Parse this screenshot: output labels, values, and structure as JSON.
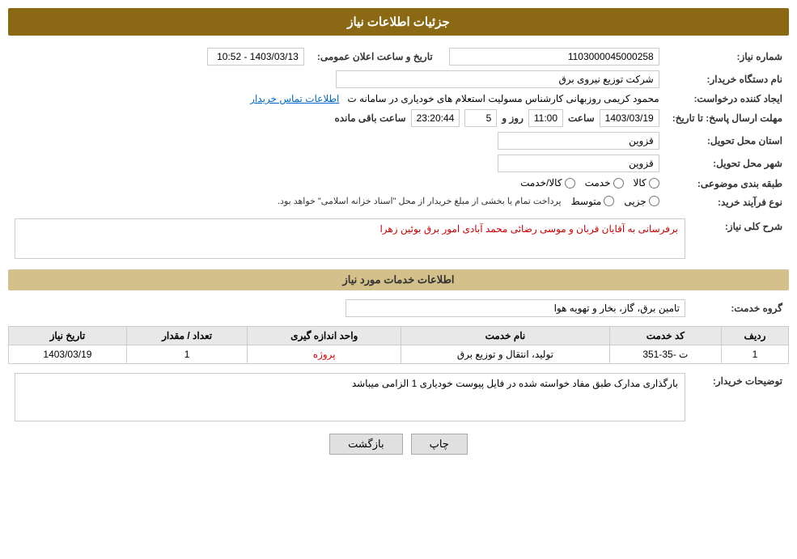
{
  "page": {
    "title": "جزئیات اطلاعات نیاز",
    "section_services": "اطلاعات خدمات مورد نیاز"
  },
  "header": {
    "announcement_label": "تاریخ و ساعت اعلان عمومی:",
    "announcement_value": "1403/03/13 - 10:52",
    "id_label": "شماره نیاز:",
    "id_value": "1103000045000258",
    "company_label": "نام دستگاه خریدار:",
    "company_value": "شرکت توزیع نیروی برق",
    "creator_label": "ایجاد کننده درخواست:",
    "creator_value": "محمود کریمی روزبهانی کارشناس  مسولیت استعلام های خودیاری در سامانه ت",
    "creator_link": "اطلاعات تماس خریدار",
    "deadline_label": "مهلت ارسال پاسخ: تا تاریخ:",
    "deadline_date": "1403/03/19",
    "deadline_time_label": "ساعت",
    "deadline_time": "11:00",
    "deadline_days_label": "روز و",
    "deadline_days": "5",
    "deadline_remaining_label": "ساعت باقی مانده",
    "deadline_remaining": "23:20:44",
    "province_label": "استان محل تحویل:",
    "province_value": "قزوین",
    "city_label": "شهر محل تحویل:",
    "city_value": "قزوین",
    "category_label": "طبقه بندی موضوعی:",
    "category_kala": "کالا",
    "category_khadamat": "خدمت",
    "category_kala_khadamat": "کالا/خدمت",
    "process_label": "نوع فرآیند خرید:",
    "process_jozyi": "جزیی",
    "process_mottaset": "متوسط",
    "process_note": "پرداخت تمام یا بخشی از مبلغ خریدار از محل \"اسناد خزانه اسلامی\" خواهد بود."
  },
  "sharah": {
    "label": "شرح کلی نیاز:",
    "value": "برفرسانی به آقایان قربان و موسی رضائی محمد آبادی امور برق بوئین زهرا"
  },
  "services": {
    "group_label": "گروه خدمت:",
    "group_value": "تامین برق، گاز، بخار و تهویه هوا",
    "table": {
      "headers": [
        "ردیف",
        "کد خدمت",
        "نام خدمت",
        "واحد اندازه گیری",
        "تعداد / مقدار",
        "تاریخ نیاز"
      ],
      "rows": [
        {
          "row": "1",
          "code": "ت -35-351",
          "name": "تولید، انتقال و توزیع برق",
          "unit": "پروژه",
          "qty": "1",
          "date": "1403/03/19"
        }
      ]
    }
  },
  "tozihat": {
    "label": "توضیحات خریدار:",
    "value": "بارگذاری مدارک طبق مفاد خواسته شده در فایل پیوست خودیاری 1 الزامی میباشد"
  },
  "buttons": {
    "print": "چاپ",
    "back": "بازگشت"
  }
}
